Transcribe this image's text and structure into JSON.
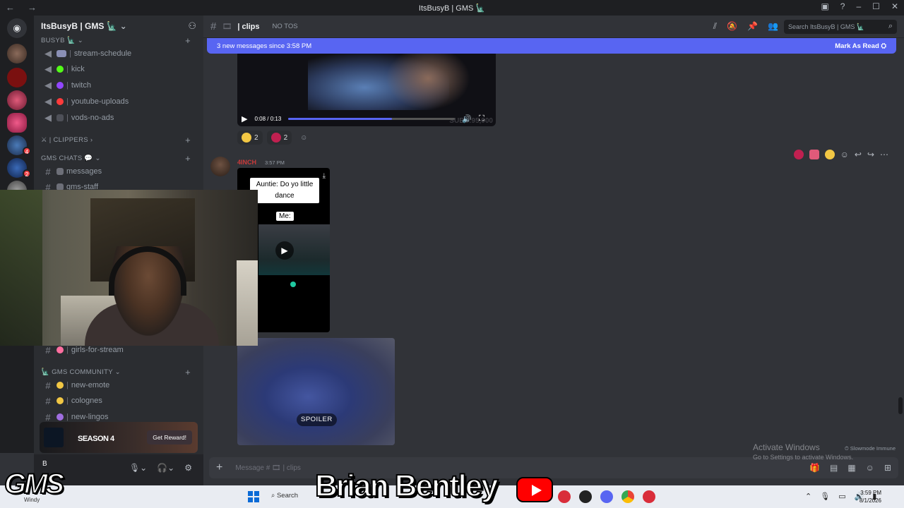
{
  "window": {
    "title": "ItsBusyB | GMS 🗽"
  },
  "server": {
    "name": "ItsBusyB | GMS 🗽"
  },
  "sidebar": {
    "category_busyb": "BUSYB 🗽",
    "channels_top": [
      {
        "name": "stream-schedule",
        "color": "#8a8fb5"
      },
      {
        "name": "kick",
        "color": "#53fc18"
      },
      {
        "name": "twitch",
        "color": "#9146ff"
      },
      {
        "name": "youtube-uploads",
        "color": "#ff3b3b"
      },
      {
        "name": "vods-no-ads",
        "color": "#6d6f78"
      }
    ],
    "category_clippers": "| CLIPPERS",
    "category_chats": "GMS CHATS 💬",
    "channels_chats": [
      {
        "name": "messages"
      },
      {
        "name": "gms-staff"
      },
      {
        "name": "girls-for-stream"
      }
    ],
    "category_community": "GMS COMMUNITY",
    "channels_community": [
      {
        "name": "new-emote"
      },
      {
        "name": "colognes"
      },
      {
        "name": "new-lingos"
      }
    ]
  },
  "promo": {
    "title": "SEASON 4",
    "button": "Get Reward!"
  },
  "user": {
    "name": "B",
    "status": "Windy"
  },
  "header": {
    "channel": "clips",
    "topic": "NO TOS",
    "search_placeholder": "Search ItsBusyB | GMS 🗽"
  },
  "banner": {
    "text": "3 new messages since 3:58 PM",
    "action": "Mark As Read"
  },
  "video1": {
    "time": "0:08 / 0:13",
    "progress": 0.62,
    "watermark": "SUBS:95,000"
  },
  "reactions": [
    {
      "emoji": "😂",
      "count": "2"
    },
    {
      "emoji": "red-emote",
      "count": "2"
    }
  ],
  "message": {
    "author": "4INCH",
    "timestamp": "3:57 PM",
    "caption1": "Auntie: Do yo little dance",
    "caption2": "Me:"
  },
  "spoiler": {
    "label": "SPOILER"
  },
  "composer": {
    "placeholder": "Message # 🎞 | clips"
  },
  "system": {
    "activate_title": "Activate Windows",
    "activate_sub": "Go to Settings to activate Windows.",
    "slowmode": "Slowmode Immune"
  },
  "taskbar": {
    "search": "Search",
    "time": "3:59 PM",
    "date": "8/1/2026"
  },
  "overlay": {
    "brand": "GMS",
    "name": "Brian Bentley"
  },
  "colors": {
    "accent": "#5865f2",
    "bg": "#313338",
    "sidebar": "#2b2d31"
  }
}
